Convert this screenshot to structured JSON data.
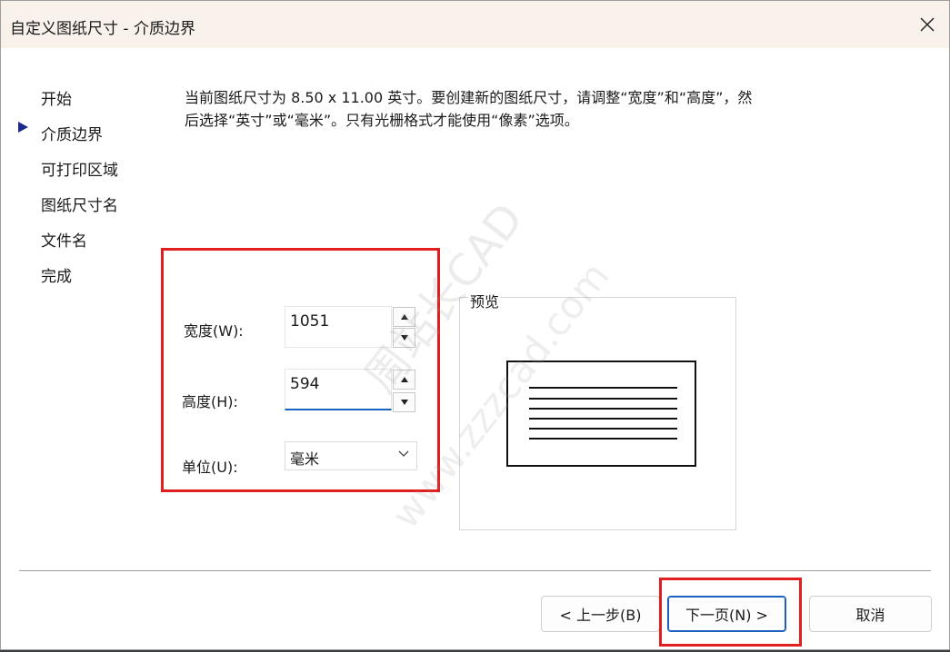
{
  "window": {
    "title": "自定义图纸尺寸 - 介质边界"
  },
  "nav": {
    "items": [
      "开始",
      "介质边界",
      "可打印区域",
      "图纸尺寸名",
      "文件名",
      "完成"
    ],
    "active_index": 1
  },
  "description": "当前图纸尺寸为 8.50 x 11.00 英寸。要创建新的图纸尺寸，请调整“宽度”和“高度”，然后选择“英寸”或“毫米”。只有光栅格式才能使用“像素”选项。",
  "form": {
    "width_label": "宽度(W):",
    "width_value": "1051",
    "height_label": "高度(H):",
    "height_value": "594",
    "unit_label": "单位(U):",
    "unit_value": "毫米"
  },
  "preview": {
    "label": "预览"
  },
  "buttons": {
    "back": "< 上一步(B)",
    "next": "下一页(N) >",
    "cancel": "取消"
  },
  "watermark": {
    "line1": "周站长CAD",
    "line2": "www.zzzcad.com"
  },
  "colors": {
    "highlight_box": "#e02020",
    "focus_underline": "#1565c0",
    "title_bar": "#f9f2ea"
  }
}
